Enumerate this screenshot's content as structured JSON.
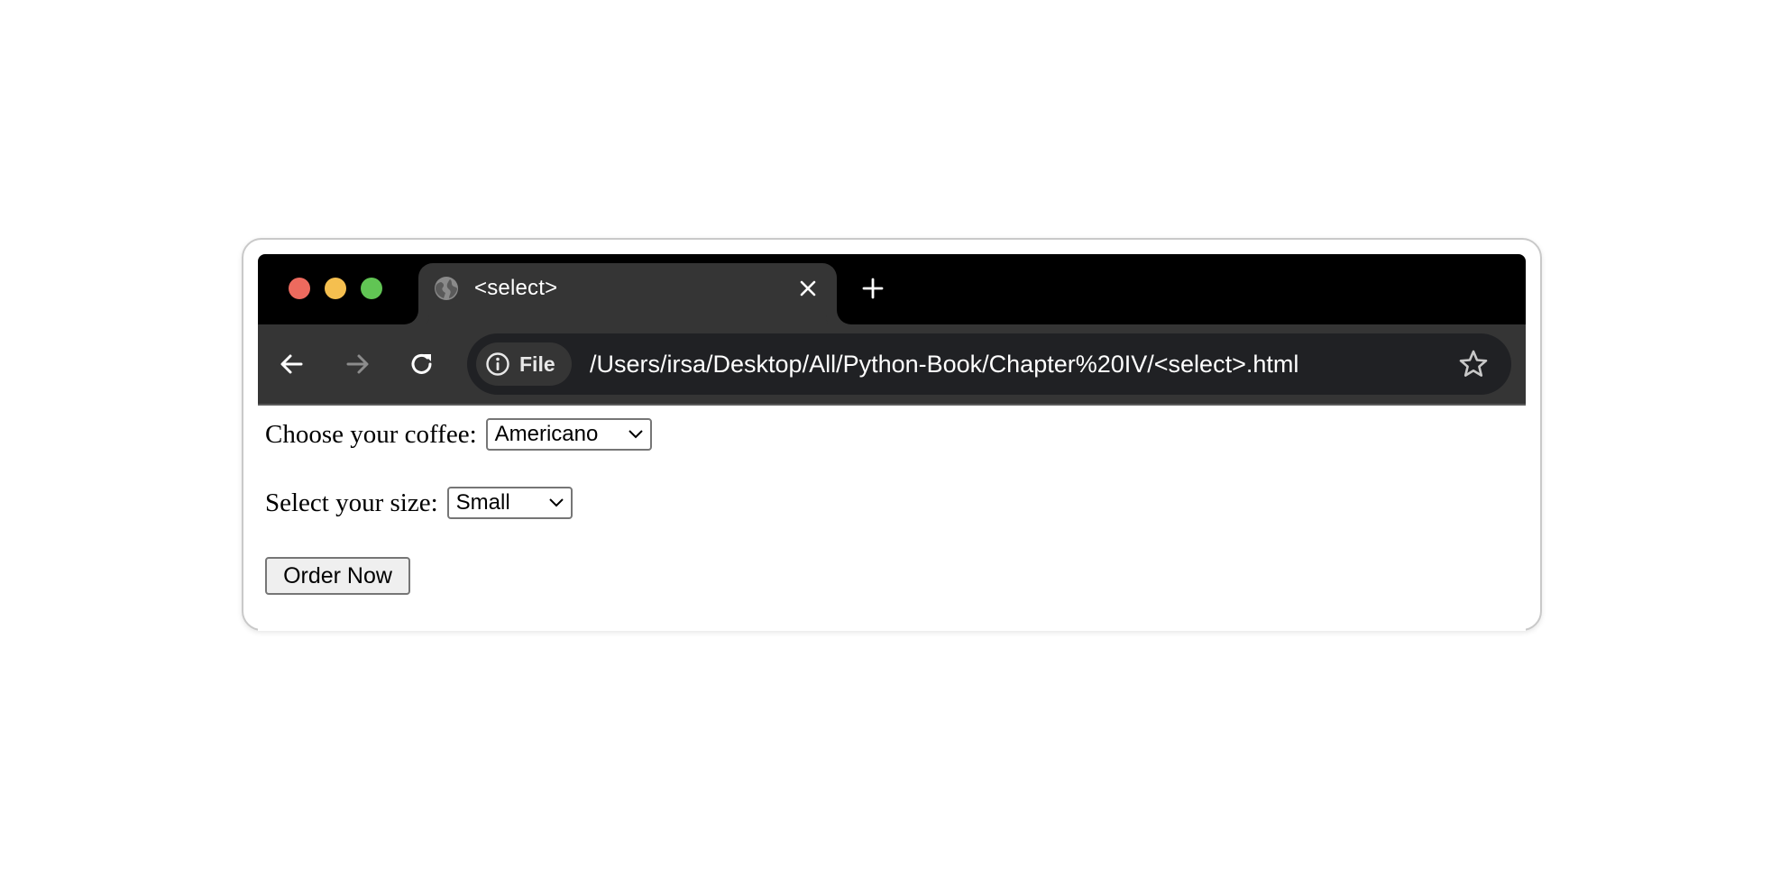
{
  "window": {
    "traffic_lights": {
      "close_color": "#ed6a5e",
      "minimize_color": "#f5bf4f",
      "maximize_color": "#61c554"
    }
  },
  "tab": {
    "title": "<select>",
    "favicon": "globe-icon",
    "close_icon": "close-icon"
  },
  "new_tab_icon": "plus-icon",
  "toolbar": {
    "back_icon": "arrow-left-icon",
    "forward_icon": "arrow-right-icon",
    "reload_icon": "reload-icon"
  },
  "omnibox": {
    "chip_icon": "info-icon",
    "chip_label": "File",
    "url": "/Users/irsa/Desktop/All/Python-Book/Chapter%20IV/<select>.html",
    "bookmark_icon": "star-icon"
  },
  "form": {
    "coffee_label": "Choose your coffee:",
    "coffee_selected": "Americano",
    "size_label": "Select your size:",
    "size_selected": "Small",
    "submit_label": "Order Now"
  }
}
